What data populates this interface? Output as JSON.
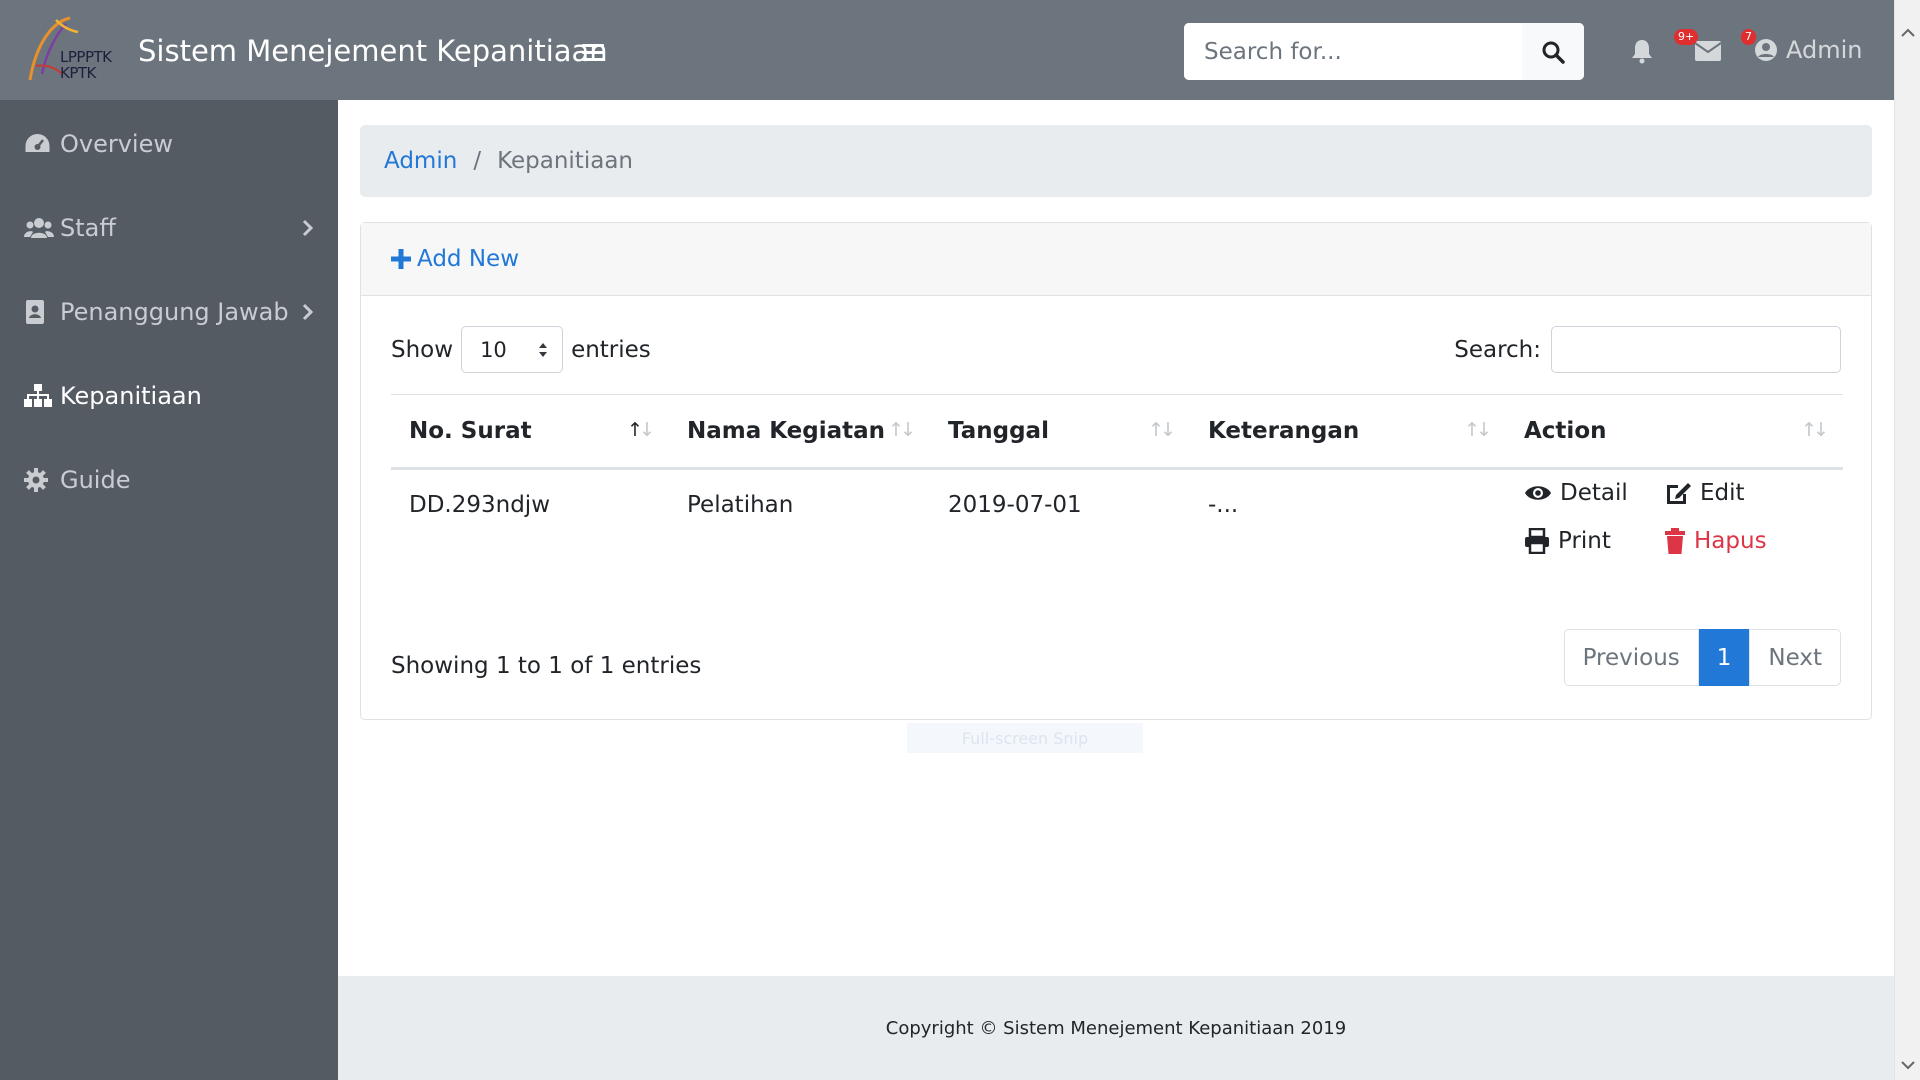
{
  "app": {
    "title": "Sistem Menejement Kepanitiaan",
    "logo_line1": "LPPPTK",
    "logo_line2": "KPTK"
  },
  "topbar": {
    "search_placeholder": "Search for...",
    "alerts_badge": "9+",
    "messages_badge": "7",
    "user_name": "Admin"
  },
  "sidebar": {
    "items": [
      {
        "label": "Overview",
        "icon": "dashboard-icon"
      },
      {
        "label": "Staff",
        "icon": "users-icon"
      },
      {
        "label": "Penanggung Jawab",
        "icon": "contact-book-icon"
      },
      {
        "label": "Kepanitiaan",
        "icon": "sitemap-icon",
        "active": true
      },
      {
        "label": "Guide",
        "icon": "gear-icon"
      }
    ]
  },
  "breadcrumb": {
    "root": "Admin",
    "separator": "/",
    "current": "Kepanitiaan"
  },
  "card": {
    "add_new_label": "Add New",
    "show_label": "Show",
    "page_size": "10",
    "entries_label": "entries",
    "search_label": "Search:"
  },
  "table": {
    "columns": [
      "No. Surat",
      "Nama Kegiatan",
      "Tanggal",
      "Keterangan",
      "Action"
    ],
    "rows": [
      {
        "no_surat": "DD.293ndjw",
        "nama_kegiatan": "Pelatihan",
        "tanggal": "2019-07-01",
        "keterangan": "-..."
      }
    ],
    "actions": {
      "detail": "Detail",
      "edit": "Edit",
      "print": "Print",
      "hapus": "Hapus"
    }
  },
  "pagination": {
    "info": "Showing 1 to 1 of 1 entries",
    "previous": "Previous",
    "current": "1",
    "next": "Next"
  },
  "overlay": {
    "snip_text": "Full-screen Snip"
  },
  "footer": {
    "text": "Copyright © Sistem Menejement Kepanitiaan 2019"
  },
  "colors": {
    "topbar": "#6c757d",
    "sidebar": "#545b62",
    "accent": "#2178d6",
    "danger": "#dc3545",
    "badge": "#e02d2d"
  }
}
